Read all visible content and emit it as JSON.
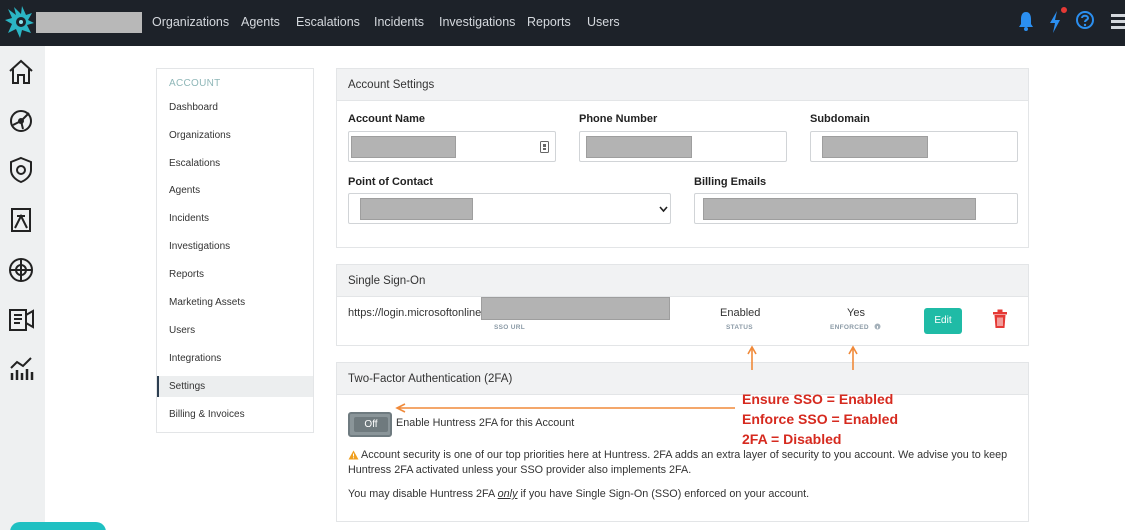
{
  "nav": {
    "items": [
      "Organizations",
      "Agents",
      "Escalations",
      "Incidents",
      "Investigations",
      "Reports",
      "Users"
    ]
  },
  "icons": {
    "logo": "huntress-logo",
    "bell": "bell-icon",
    "lightning": "lightning-icon",
    "help": "help-circle-icon",
    "menu": "hamburger-menu-icon"
  },
  "colors": {
    "topbar": "#1d2229",
    "accent": "#1fbba6",
    "danger": "#e53935",
    "annotation": "#d62a1f",
    "arrow": "#f08a3a"
  },
  "sidebar": {
    "title": "ACCOUNT",
    "items": [
      "Dashboard",
      "Organizations",
      "Escalations",
      "Agents",
      "Incidents",
      "Investigations",
      "Reports",
      "Marketing Assets",
      "Users",
      "Integrations",
      "Settings",
      "Billing & Invoices"
    ],
    "active": "Settings"
  },
  "account_settings": {
    "title": "Account Settings",
    "account_name_label": "Account Name",
    "phone_label": "Phone Number",
    "subdomain_label": "Subdomain",
    "contact_label": "Point of Contact",
    "billing_label": "Billing Emails"
  },
  "sso": {
    "title": "Single Sign-On",
    "url": "https://login.microsoftonline",
    "url_caption": "SSO URL",
    "status": "Enabled",
    "status_caption": "STATUS",
    "enforced": "Yes",
    "enforced_caption": "ENFORCED",
    "edit_label": "Edit"
  },
  "twofa": {
    "title": "Two-Factor Authentication (2FA)",
    "toggle_label": "Off",
    "enable_text": "Enable Huntress 2FA for this Account",
    "warning_text": "Account security is one of our top priorities here at Huntress. 2FA adds an extra layer of security to you account. We advise you to keep Huntress 2FA activated unless your SSO provider also implements 2FA.",
    "disable_before": "You may disable Huntress 2FA ",
    "disable_emph": "only",
    "disable_after": " if you have Single Sign-On (SSO) enforced on your account."
  },
  "annotations": [
    "Ensure SSO = Enabled",
    "Enforce SSO = Enabled",
    "2FA = Disabled"
  ]
}
